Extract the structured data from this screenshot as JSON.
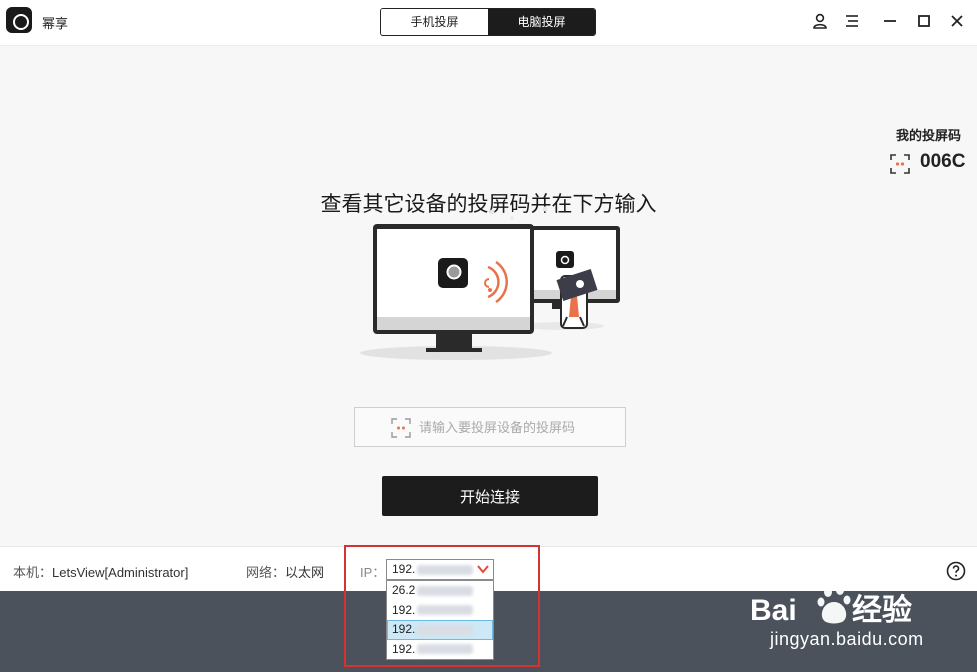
{
  "app": {
    "title": "幂享"
  },
  "mode_tabs": [
    {
      "label": "手机投屏",
      "active": false
    },
    {
      "label": "电脑投屏",
      "active": true
    }
  ],
  "window_controls": [
    "user-icon",
    "menu-icon",
    "minimize-icon",
    "maximize-icon",
    "close-icon"
  ],
  "main": {
    "headline": "查看其它设备的投屏码并在下方输入",
    "my_code_label": "我的投屏码",
    "my_code_value": "006C",
    "code_input_placeholder": "请输入要投屏设备的投屏码",
    "connect_button": "开始连接"
  },
  "status": {
    "host_label": "本机：",
    "host_value": "LetsView[Administrator]",
    "network_label": "网络：",
    "network_value": "以太网",
    "ip_label": "IP：",
    "ip_selected": "192.",
    "ip_options": [
      "26.2",
      "192.",
      "192.",
      "192."
    ],
    "ip_selected_index": 2
  },
  "watermark": {
    "sub": "jingyan.baidu.com"
  },
  "colors": {
    "accent": "#1c1c1c",
    "highlight_box": "#d63232",
    "bottom_strip": "#4b525c",
    "wave_orange": "#e8734a"
  }
}
